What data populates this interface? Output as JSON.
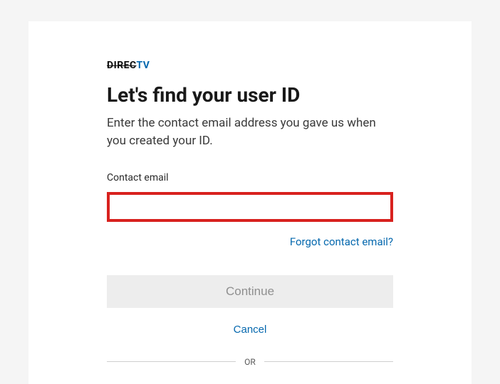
{
  "logo": {
    "direc": "DIREC",
    "tv": "TV"
  },
  "heading": "Let's find your user ID",
  "subtitle": "Enter the contact email address you gave us when you created your ID.",
  "form": {
    "email_label": "Contact email",
    "email_value": "",
    "forgot_link": "Forgot contact email?",
    "continue_label": "Continue",
    "cancel_label": "Cancel"
  },
  "divider_label": "OR"
}
